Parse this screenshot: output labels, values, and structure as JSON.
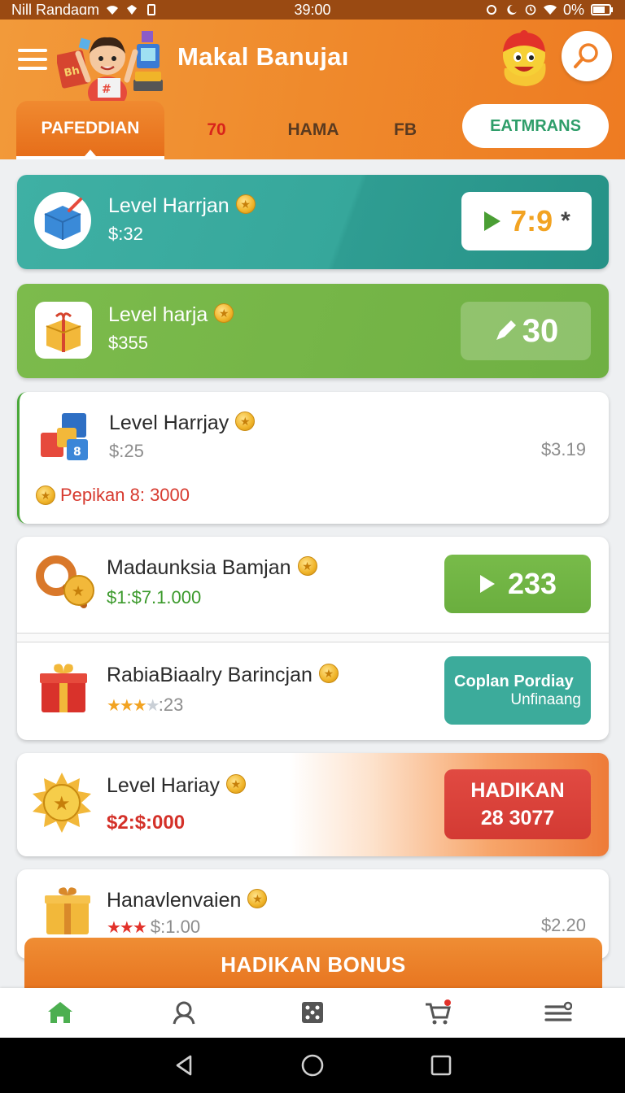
{
  "status_bar": {
    "carrier": "Nill Randaɑm",
    "time": "39:00",
    "battery": "0%"
  },
  "header": {
    "title": "Makal Banujaı"
  },
  "tabs": [
    {
      "label": "PAFEDDIAN"
    },
    {
      "label": "70"
    },
    {
      "label": "HAMA"
    },
    {
      "label": "FB"
    },
    {
      "label": "EATMRANS"
    }
  ],
  "cards": [
    {
      "title": "Level Harrjan",
      "subtitle": "$:32",
      "button_value": "7:9",
      "button_symbol": "*"
    },
    {
      "title": "Level harja",
      "subtitle": "$355",
      "button_value": "30"
    },
    {
      "title": "Level Harrjay",
      "subtitle": "$:25",
      "right_value": "$3.19",
      "promo": "Pepikan 8: 3000"
    },
    {
      "title": "Madaunksia Bamjan",
      "subtitle": "$1:$7.1.000",
      "button_value": "233"
    },
    {
      "title": "RabiaBiaalry Barincjan",
      "rating": ":23",
      "button_line1": "Coplan Pordiay",
      "button_line2": "Unfinaang"
    },
    {
      "title": "Level Hariay",
      "subtitle": "$2:$:000",
      "button_line1": "HADIKAN",
      "button_line2": "28 3077"
    },
    {
      "title": "Hanavlenvaien",
      "subtitle": "$:1.00",
      "right_value": "$2.20"
    }
  ],
  "bonus_button": {
    "label": "HADIKAN BONUS"
  },
  "colors": {
    "brand_orange": "#ee7b22",
    "teal": "#3fb0a4",
    "green": "#7cbb4c",
    "red": "#d33a33"
  }
}
